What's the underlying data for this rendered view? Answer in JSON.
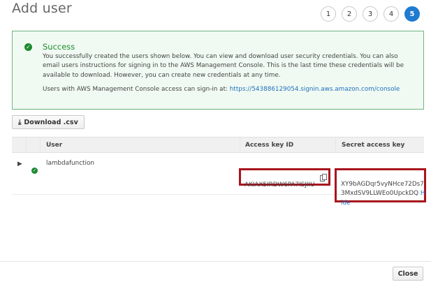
{
  "page": {
    "title": "Add user"
  },
  "steps": [
    "1",
    "2",
    "3",
    "4",
    "5"
  ],
  "alert": {
    "heading": "Success",
    "message": "You successfully created the users shown below. You can view and download user security credentials. You can also email users instructions for signing in to the AWS Management Console. This is the last time these credentials will be available to download. However, you can create new credentials at any time.",
    "signin_prefix": "Users with AWS Management Console access can sign-in at:",
    "signin_url": "https://543886129054.signin.aws.amazon.com/console",
    "icon": "check-circle-icon"
  },
  "toolbar": {
    "download_label": "Download .csv",
    "download_icon": "download-icon"
  },
  "table": {
    "headers": {
      "user": "User",
      "access_key": "Access key ID",
      "secret_key": "Secret access key"
    },
    "rows": [
      {
        "user": "lambdafunction",
        "access_key_id": "AKIAX5IRDW6PA7ISJIIU",
        "secret_access_key": "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",
        "hide_label": "Hide"
      }
    ]
  },
  "footer": {
    "close_label": "Close"
  },
  "colors": {
    "success": "#1d8a30",
    "active_step": "#1f7ad1",
    "link": "#1f6fbf",
    "highlight": "#a8141d"
  }
}
